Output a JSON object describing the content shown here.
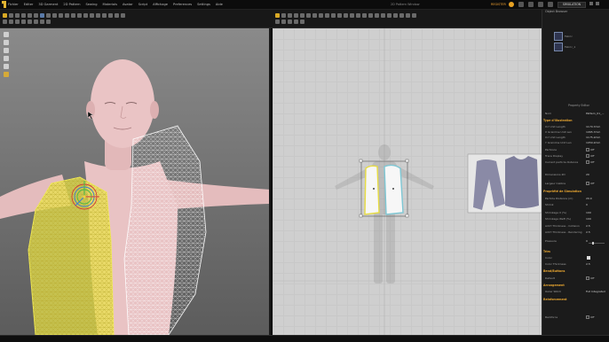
{
  "menubar": {
    "items": [
      "Fichier",
      "Editer",
      "3D Garment",
      "2D Pattern",
      "Sewing",
      "Materials",
      "Avatar",
      "Script",
      "Affichage",
      "Preferences",
      "Settings",
      "Aide"
    ],
    "center_title": "2D Pattern Window",
    "version_badge": "REGISTER",
    "simulation_label": "SIMULATION"
  },
  "viewport2d": {
    "label": "2D Pattern Window"
  },
  "panel": {
    "header": "Object Browser",
    "items": [
      {
        "label": "Fabric"
      },
      {
        "label": "Fabric_1"
      }
    ],
    "property_title": "Property Editor",
    "name_label": "Nom",
    "name_value": "Pattern_01_...",
    "sections": {
      "layout": "Type d'Illustration",
      "particle": "Propriété de Simulation",
      "trim": "Trim",
      "bend": "Bend/Buttons",
      "arrangement": "Arrangement",
      "reinforce": "Reinforcement"
    },
    "rows": [
      {
        "label": "X-Y Unit Length",
        "value": "1170.7mm"
      },
      {
        "label": "X Grainline Unit Len",
        "value": "1065.7mm"
      },
      {
        "label": "X-Y Unit Length",
        "value": "1175.2mm"
      },
      {
        "label": "Y Grainline Unit Len",
        "value": "1050.2mm"
      },
      {
        "label": "Particule",
        "check": "Off"
      },
      {
        "label": "Trace Display",
        "check": "Off"
      },
      {
        "label": "Current particle distance",
        "check": "Off"
      },
      {
        "label": "Dimensions 2D",
        "value": "20"
      },
      {
        "label": "Largeur Calibre",
        "check": "Off"
      },
      {
        "label": "Particle Distance (m)",
        "value": "20.0"
      },
      {
        "label": "Shrink",
        "value": "0"
      },
      {
        "label": "Shrinkage X (%)",
        "value": "100"
      },
      {
        "label": "Shrinkage Weft (%)",
        "value": "100"
      },
      {
        "label": "Add'l Thickness - Collision",
        "value": "2.5"
      },
      {
        "label": "Add'l Thickness - Rendering",
        "value": "2.5"
      },
      {
        "label": "Pressure",
        "value": "0"
      },
      {
        "label": "Color",
        "value": ""
      },
      {
        "label": "Color Thickness",
        "value": "2.5"
      },
      {
        "label": "Default",
        "check": "Off"
      },
      {
        "label": "Outer Stitch",
        "value": "Full Integrated"
      },
      {
        "label": "Reinforce",
        "check": "Off"
      }
    ]
  },
  "colors": {
    "accent": "#e6a430",
    "yellow_pattern": "#e8e24a",
    "skin": "#e9c3c4",
    "pattern_outline": "#7aa6d6"
  }
}
